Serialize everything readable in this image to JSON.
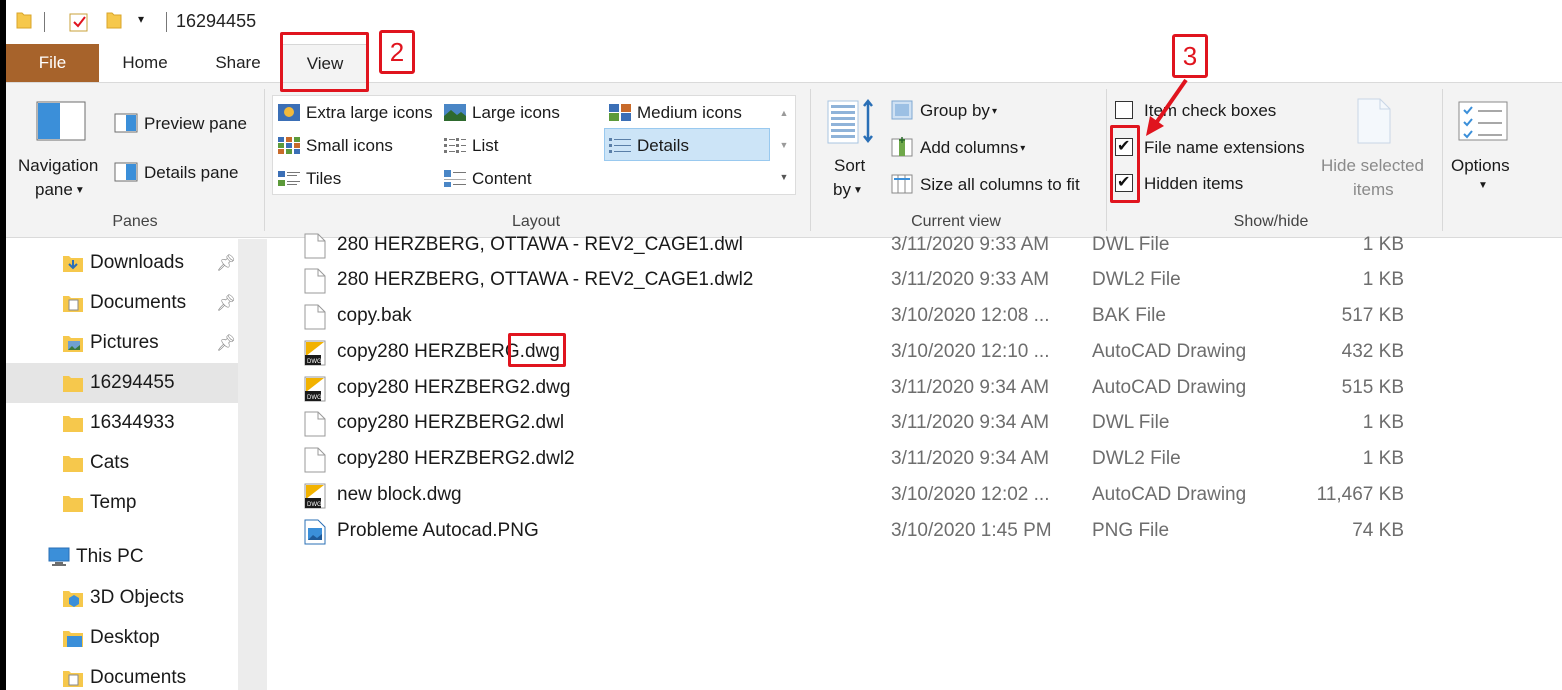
{
  "window": {
    "title": "16294455"
  },
  "tabs": {
    "file": "File",
    "home": "Home",
    "share": "Share",
    "view": "View"
  },
  "ribbon": {
    "panes": {
      "navigation_pane_line1": "Navigation",
      "navigation_pane_line2": "pane",
      "preview_pane": "Preview pane",
      "details_pane": "Details pane",
      "group_label": "Panes"
    },
    "layout": {
      "extra_large_icons": "Extra large icons",
      "large_icons": "Large icons",
      "medium_icons": "Medium icons",
      "small_icons": "Small icons",
      "list": "List",
      "details": "Details",
      "tiles": "Tiles",
      "content": "Content",
      "group_label": "Layout",
      "selected": "Details"
    },
    "current_view": {
      "sort_by_line1": "Sort",
      "sort_by_line2": "by",
      "group_by": "Group by",
      "add_columns": "Add columns",
      "size_all_columns": "Size all columns to fit",
      "group_label": "Current view"
    },
    "show_hide": {
      "item_check_boxes": "Item check boxes",
      "item_check_boxes_checked": false,
      "file_name_extensions": "File name extensions",
      "file_name_extensions_checked": true,
      "hidden_items": "Hidden items",
      "hidden_items_checked": true,
      "hide_selected_line1": "Hide selected",
      "hide_selected_line2": "items",
      "group_label": "Show/hide"
    },
    "options": {
      "label": "Options"
    }
  },
  "nav": {
    "items": [
      {
        "label": "Downloads",
        "icon": "downloads-folder-icon",
        "pinned": true
      },
      {
        "label": "Documents",
        "icon": "documents-folder-icon",
        "pinned": true
      },
      {
        "label": "Pictures",
        "icon": "pictures-folder-icon",
        "pinned": true
      },
      {
        "label": "16294455",
        "icon": "folder-icon",
        "selected": true
      },
      {
        "label": "16344933",
        "icon": "folder-icon"
      },
      {
        "label": "Cats",
        "icon": "folder-icon"
      },
      {
        "label": "Temp",
        "icon": "folder-icon"
      },
      {
        "label": "This PC",
        "icon": "computer-icon"
      },
      {
        "label": "3D Objects",
        "icon": "3d-objects-folder-icon"
      },
      {
        "label": "Desktop",
        "icon": "desktop-folder-icon"
      },
      {
        "label": "Documents",
        "icon": "documents-folder-icon"
      }
    ]
  },
  "files": [
    {
      "name": "280 HERZBERG, OTTAWA - REV2_CAGE1.dwl",
      "date": "3/11/2020 9:33 AM",
      "type": "DWL File",
      "size": "1 KB",
      "icon": "generic-file-icon"
    },
    {
      "name": "280 HERZBERG, OTTAWA - REV2_CAGE1.dwl2",
      "date": "3/11/2020 9:33 AM",
      "type": "DWL2 File",
      "size": "1 KB",
      "icon": "generic-file-icon"
    },
    {
      "name": "copy.bak",
      "date": "3/10/2020 12:08 ...",
      "type": "BAK File",
      "size": "517 KB",
      "icon": "generic-file-icon"
    },
    {
      "name": "copy280 HERZBERG.dwg",
      "date": "3/10/2020 12:10 ...",
      "type": "AutoCAD Drawing",
      "size": "432 KB",
      "icon": "dwg-file-icon"
    },
    {
      "name": "copy280 HERZBERG2.dwg",
      "date": "3/11/2020 9:34 AM",
      "type": "AutoCAD Drawing",
      "size": "515 KB",
      "icon": "dwg-file-icon"
    },
    {
      "name": "copy280 HERZBERG2.dwl",
      "date": "3/11/2020 9:34 AM",
      "type": "DWL File",
      "size": "1 KB",
      "icon": "generic-file-icon"
    },
    {
      "name": "copy280 HERZBERG2.dwl2",
      "date": "3/11/2020 9:34 AM",
      "type": "DWL2 File",
      "size": "1 KB",
      "icon": "generic-file-icon"
    },
    {
      "name": "new block.dwg",
      "date": "3/10/2020 12:02 ...",
      "type": "AutoCAD Drawing",
      "size": "11,467 KB",
      "icon": "dwg-file-icon"
    },
    {
      "name": "Probleme Autocad.PNG",
      "date": "3/10/2020 1:45 PM",
      "type": "PNG File",
      "size": "74 KB",
      "icon": "image-file-icon"
    }
  ],
  "annotations": {
    "step2": "2",
    "step3": "3"
  },
  "colors": {
    "file_tab": "#a7632b",
    "annotation_red": "#e0141e",
    "selection": "#cce4f7"
  }
}
